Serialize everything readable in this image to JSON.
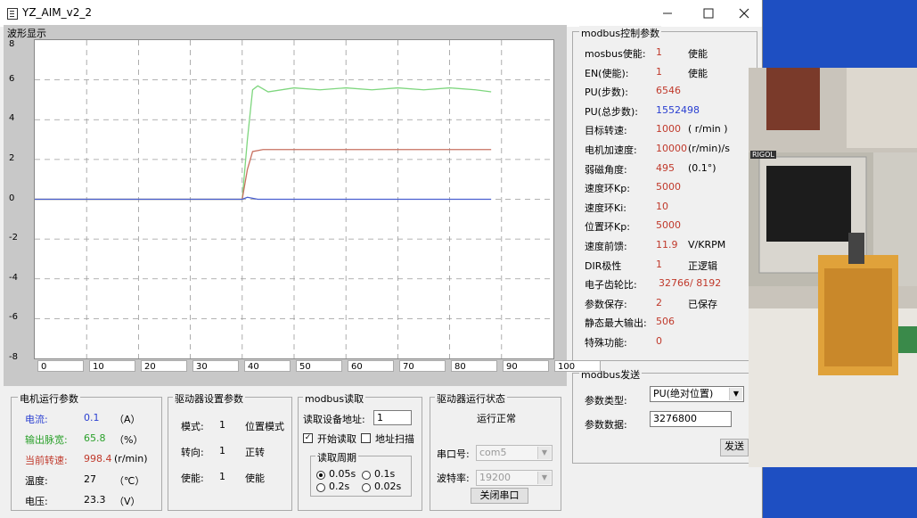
{
  "window": {
    "title": "YZ_AIM_v2_2"
  },
  "waveform": {
    "label": "波形显示",
    "y_ticks": [
      "8",
      "6",
      "4",
      "2",
      "0",
      "-2",
      "-4",
      "-6",
      "-8"
    ],
    "x_ticks": [
      "0",
      "10",
      "20",
      "30",
      "40",
      "50",
      "60",
      "70",
      "80",
      "90",
      "100"
    ]
  },
  "chart_data": {
    "type": "line",
    "xlim": [
      0,
      100
    ],
    "ylim": [
      -8,
      8
    ],
    "grid": true,
    "series": [
      {
        "color": "#7ed67e",
        "x": [
          0,
          40,
          41,
          42,
          43,
          45,
          50,
          55,
          60,
          65,
          70,
          75,
          80,
          85,
          88
        ],
        "y": [
          0,
          0,
          3,
          5.5,
          5.7,
          5.4,
          5.6,
          5.5,
          5.6,
          5.5,
          5.6,
          5.5,
          5.6,
          5.5,
          5.4
        ]
      },
      {
        "color": "#c87060",
        "x": [
          0,
          40,
          41,
          42,
          44,
          50,
          60,
          70,
          80,
          88
        ],
        "y": [
          0,
          0,
          1.5,
          2.4,
          2.5,
          2.5,
          2.5,
          2.5,
          2.5,
          2.5
        ]
      },
      {
        "color": "#4a5fd0",
        "x": [
          0,
          40,
          41,
          42,
          43,
          88
        ],
        "y": [
          0,
          0,
          0.1,
          0.05,
          0,
          0
        ]
      }
    ]
  },
  "motor_params": {
    "title": "电机运行参数",
    "rows": [
      {
        "label": "电流:",
        "value": "0.1",
        "unit": "（A）",
        "color": "#2a3fd1"
      },
      {
        "label": "输出脉宽:",
        "value": "65.8",
        "unit": "（%）",
        "color": "#2aa02a"
      },
      {
        "label": "当前转速:",
        "value": "998.4",
        "unit": "(r/min)",
        "color": "#c0392b"
      },
      {
        "label": "温度:",
        "value": "27",
        "unit": "（℃）",
        "color": "#000000"
      },
      {
        "label": "电压:",
        "value": "23.3",
        "unit": "（V）",
        "color": "#000000"
      }
    ]
  },
  "driver_settings": {
    "title": "驱动器设置参数",
    "rows": [
      {
        "label": "模式:",
        "value": "1",
        "desc": "位置模式"
      },
      {
        "label": "转向:",
        "value": "1",
        "desc": "正转"
      },
      {
        "label": "使能:",
        "value": "1",
        "desc": "使能"
      }
    ]
  },
  "modbus_read": {
    "title": "modbus读取",
    "addr_label": "读取设备地址:",
    "addr_value": "1",
    "start_read_label": "开始读取",
    "start_read_checked": "✓",
    "addr_scan_label": "地址扫描",
    "period_title": "读取周期",
    "periods": [
      "0.05s",
      "0.1s",
      "0.2s",
      "0.02s"
    ]
  },
  "driver_status": {
    "title": "驱动器运行状态",
    "status": "运行正常",
    "port_label": "串口号:",
    "port_value": "com5",
    "baud_label": "波特率:",
    "baud_value": "19200",
    "close_btn": "关闭串口"
  },
  "modbus_control": {
    "title": "modbus控制参数",
    "rows": [
      {
        "label": "mosbus使能:",
        "value": "1",
        "desc": "使能",
        "color": "#c0392b"
      },
      {
        "label": "EN(使能):",
        "value": "1",
        "desc": "使能",
        "color": "#c0392b"
      },
      {
        "label": "PU(步数):",
        "value": "6546",
        "desc": "",
        "color": "#c0392b"
      },
      {
        "label": "PU(总步数):",
        "value": "1552498",
        "desc": "",
        "color": "#2a3fd1"
      },
      {
        "label": "目标转速:",
        "value": "1000",
        "desc": "( r/min )",
        "color": "#c0392b"
      },
      {
        "label": "电机加速度:",
        "value": "10000",
        "desc": "(r/min)/s",
        "color": "#c0392b"
      },
      {
        "label": "弱磁角度:",
        "value": "495",
        "desc": "(0.1°)",
        "color": "#c0392b"
      },
      {
        "label": "速度环Kp:",
        "value": "5000",
        "desc": "",
        "color": "#c0392b"
      },
      {
        "label": "速度环Ki:",
        "value": "10",
        "desc": "",
        "color": "#c0392b"
      },
      {
        "label": "位置环Kp:",
        "value": "5000",
        "desc": "",
        "color": "#c0392b"
      },
      {
        "label": "速度前馈:",
        "value": "11.9",
        "desc": "V/KRPM",
        "color": "#c0392b"
      },
      {
        "label": "DIR极性",
        "value": "1",
        "desc": "正逻辑",
        "color": "#c0392b"
      },
      {
        "label": "电子齿轮比:",
        "value": "32766/ 8192",
        "desc": "",
        "color": "#c0392b"
      },
      {
        "label": "参数保存:",
        "value": "2",
        "desc": "已保存",
        "color": "#c0392b"
      },
      {
        "label": "静态最大输出:",
        "value": "506",
        "desc": "",
        "color": "#c0392b"
      },
      {
        "label": "特殊功能:",
        "value": "0",
        "desc": "",
        "color": "#c0392b"
      }
    ]
  },
  "modbus_send": {
    "title": "modbus发送",
    "type_label": "参数类型:",
    "type_value": "PU(绝对位置)",
    "data_label": "参数数据:",
    "data_value": "3276800",
    "send_btn": "发送"
  },
  "video": {
    "brand": "RIGOL"
  }
}
